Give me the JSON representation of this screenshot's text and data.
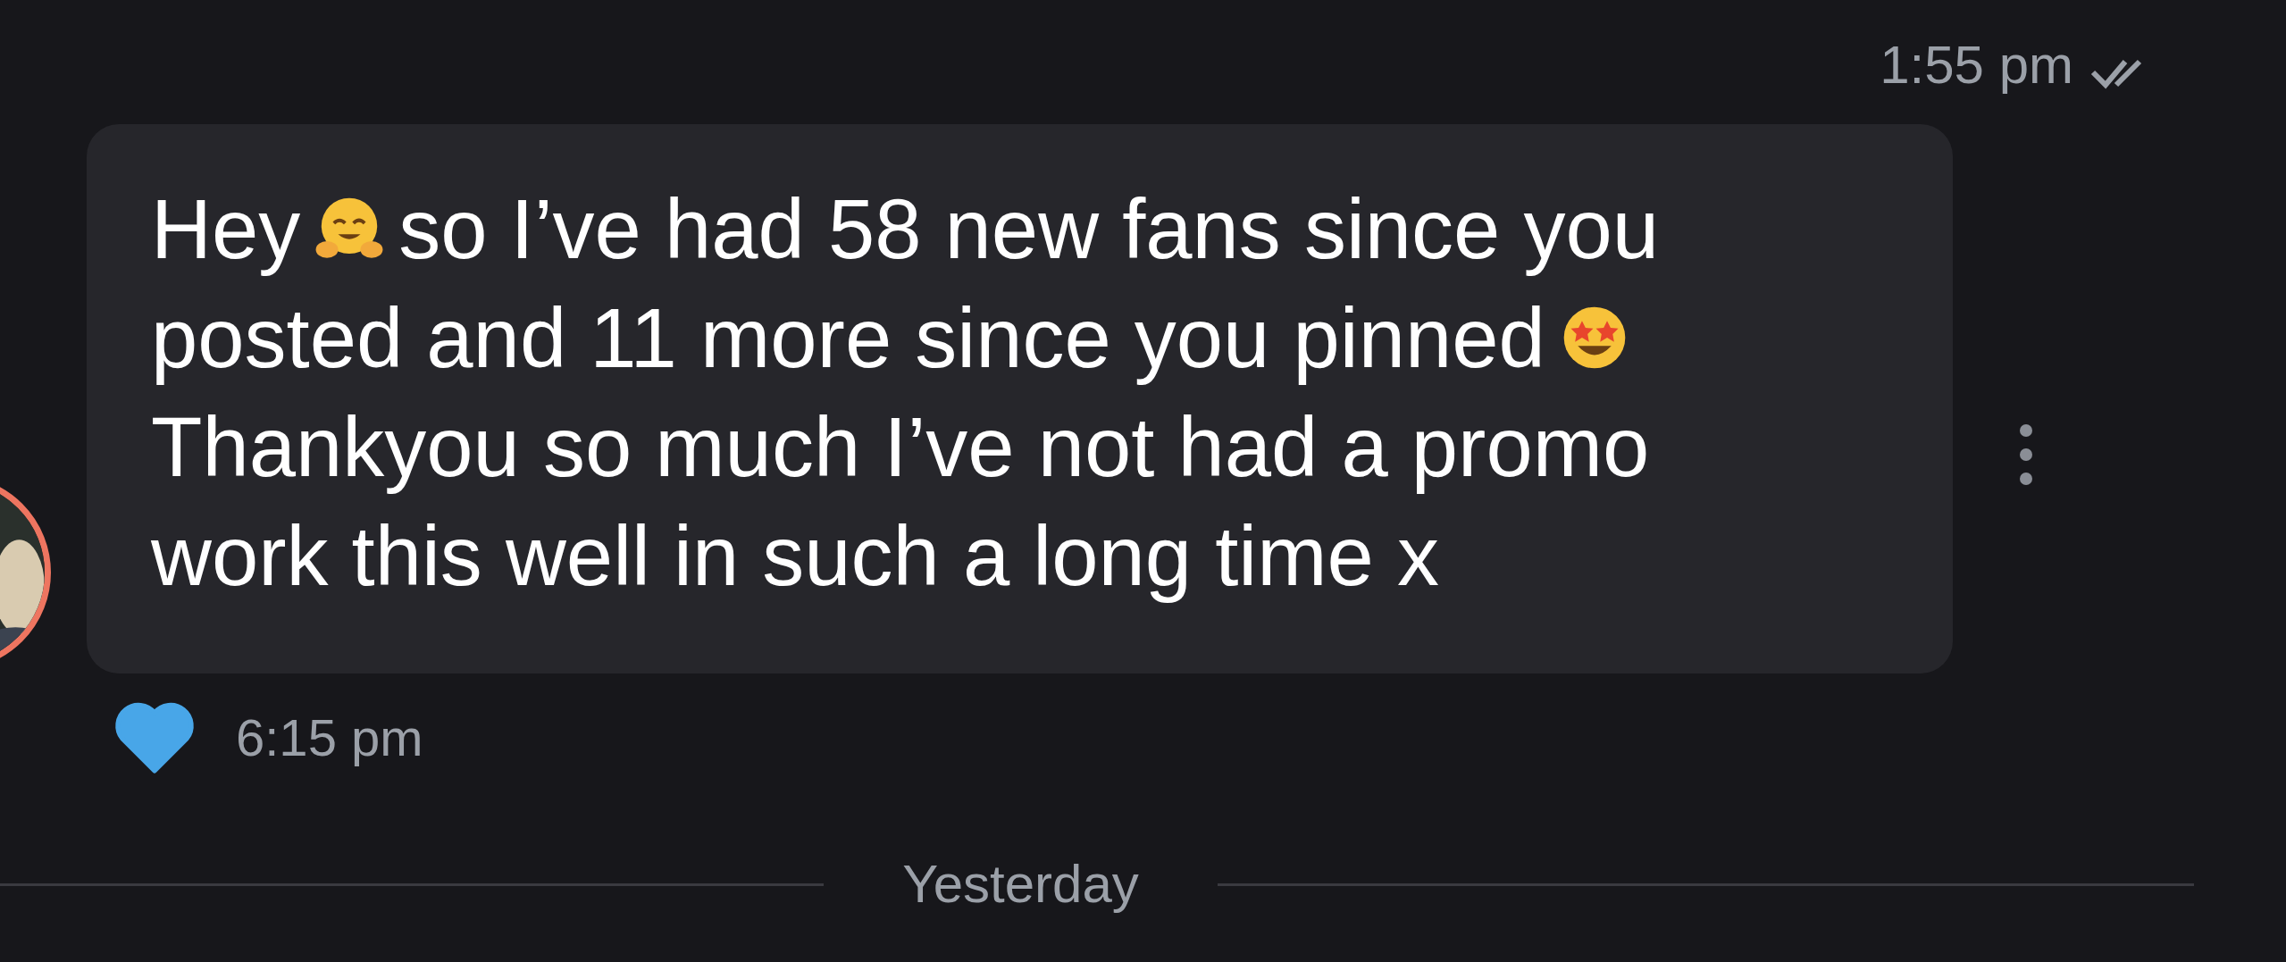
{
  "sent_message": {
    "time": "1:55 pm",
    "read": true
  },
  "received_message": {
    "lines": [
      [
        {
          "kind": "text",
          "text": "Hey"
        },
        {
          "kind": "hug_emoji"
        },
        {
          "kind": "text",
          "text": "so I’ve had 58 new fans since you"
        }
      ],
      [
        {
          "kind": "text",
          "text": "posted and 11 more since you pinned"
        },
        {
          "kind": "star_eyes_emoji"
        }
      ],
      [
        {
          "kind": "text",
          "text": "Thankyou so much I’ve not had a promo"
        }
      ],
      [
        {
          "kind": "text",
          "text": "work this well in such a long time x"
        }
      ]
    ],
    "liked": true,
    "time": "6:15 pm",
    "avatar": {
      "kind": "picture"
    }
  },
  "date_divider": "Yesterday"
}
